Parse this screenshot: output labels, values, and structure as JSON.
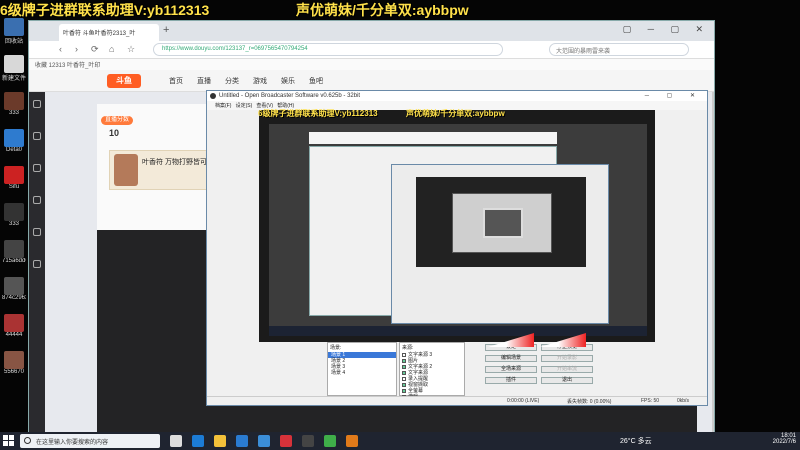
{
  "overlays": {
    "left_banner": "6级牌子进群联系助理V:yb112313",
    "right_banner": "声优萌妹/千分单双:aybbpw",
    "nested_left": "6级牌子进群联系助理V:yb112313",
    "nested_right": "声优萌妹/千分单双:aybbpw"
  },
  "desktop": {
    "icons": [
      {
        "label": "回收站",
        "color": "#3a6fb0"
      },
      {
        "label": "新建文件",
        "color": "#d8d8d8"
      },
      {
        "label": "333",
        "color": "#6b3a2a"
      },
      {
        "label": "Deta0",
        "color": "#2e7bcf"
      },
      {
        "label": "Sifu",
        "color": "#cc2222"
      },
      {
        "label": "333",
        "color": "#333"
      },
      {
        "label": "715a6dd6",
        "color": "#444"
      },
      {
        "label": "874c2963",
        "color": "#555"
      },
      {
        "label": "44444",
        "color": "#a33"
      },
      {
        "label": "556670",
        "color": "#854"
      }
    ]
  },
  "browser": {
    "tab_title": "叶香符 斗鱼叶香符2313_叶",
    "new_tab": "+",
    "window_controls": "▢ ─ ▢ ✕",
    "url": "https://www.douyu.com/123137_r=0697565470794254",
    "search_box": "大范围的暴雨雷来袭",
    "bookmarks": "收藏   12313   叶香符_叶印",
    "nav_icons": [
      "‹",
      "›",
      "⟳",
      "⌂",
      "☆"
    ],
    "site": {
      "logo": "斗鱼",
      "nav": [
        "首页",
        "直播",
        "分类",
        "游戏",
        "娱乐",
        "鱼吧"
      ],
      "badge": "直播分数",
      "rank": "10",
      "streamer_name": "叶香符 万物打野皆可"
    }
  },
  "obs": {
    "title": "Untitled - Open Broadcaster Software v0.625b - 32bit",
    "menu": [
      "档案(F)",
      "设定(S)",
      "查看(V)",
      "帮助(H)"
    ],
    "window_controls": "─ ▢ ✕",
    "scenes_header": "场景:",
    "scenes": [
      {
        "name": "场景 1",
        "selected": true
      },
      {
        "name": "场景 2",
        "selected": false
      },
      {
        "name": "场景 3",
        "selected": false
      },
      {
        "name": "场景 4",
        "selected": false
      }
    ],
    "sources_header": "来源:",
    "sources": [
      {
        "name": "文字来源 3",
        "checked": false
      },
      {
        "name": "图片",
        "checked": true
      },
      {
        "name": "文字来源 2",
        "checked": true
      },
      {
        "name": "文字来源",
        "checked": true
      },
      {
        "name": "录入提醒",
        "checked": false
      },
      {
        "name": "视窗撷取",
        "checked": true
      },
      {
        "name": "全萤幕",
        "checked": true
      },
      {
        "name": "游戏",
        "checked": false
      }
    ],
    "buttons": [
      {
        "label": "设定",
        "disabled": false
      },
      {
        "label": "停止预览",
        "disabled": false
      },
      {
        "label": "编辑场景",
        "disabled": false
      },
      {
        "label": "开始录影",
        "disabled": true
      },
      {
        "label": "全场来源",
        "disabled": false
      },
      {
        "label": "开始串流",
        "disabled": true
      },
      {
        "label": "插件",
        "disabled": false
      },
      {
        "label": "退出",
        "disabled": false
      }
    ],
    "status": {
      "time": "0:00:00 (LIVE)",
      "dropped": "丢失帧数: 0 (0.00%)",
      "fps": "FPS: 50",
      "bitrate": "0kb/s"
    }
  },
  "taskbar": {
    "search_placeholder": "在这里输入你要搜索的内容",
    "weather": "26°C 多云",
    "time": "18:01",
    "date": "2022/7/6",
    "apps": [
      {
        "name": "task-view",
        "color": "#ddd"
      },
      {
        "name": "edge",
        "color": "#1c7cd6"
      },
      {
        "name": "explorer",
        "color": "#f3c13a"
      },
      {
        "name": "store",
        "color": "#2a7bd1"
      },
      {
        "name": "mail",
        "color": "#3b8ed8"
      },
      {
        "name": "app-red",
        "color": "#d6323a"
      },
      {
        "name": "obs",
        "color": "#444"
      },
      {
        "name": "browser",
        "color": "#3fae49"
      },
      {
        "name": "app-orange",
        "color": "#e07a1a"
      }
    ]
  }
}
